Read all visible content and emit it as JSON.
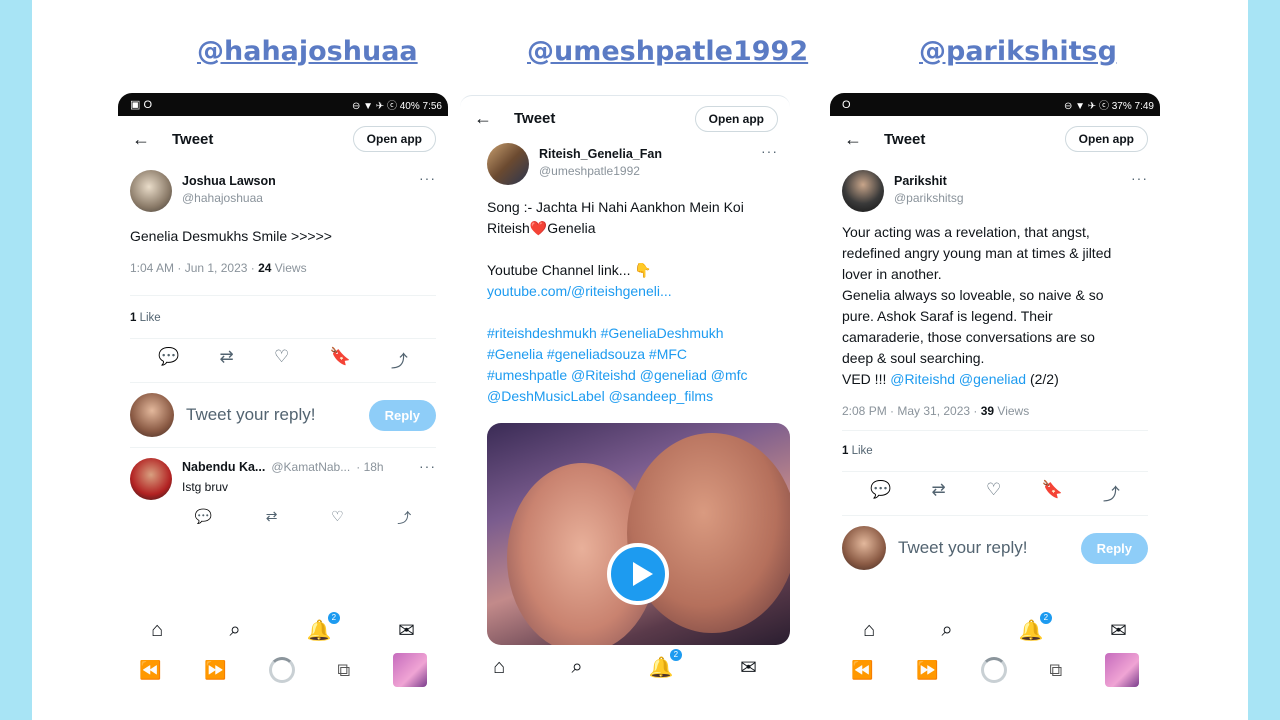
{
  "panels": [
    {
      "handle": "@hahajoshuaa",
      "status": {
        "left": "▣ O",
        "right": "⊖ ▼ ✈ ⓒ 40% 7:56"
      },
      "header": {
        "back": "←",
        "title": "Tweet",
        "open_app": "Open app"
      },
      "author": {
        "name": "Joshua Lawson",
        "handle": "@hahajoshuaa",
        "more": "···"
      },
      "text": "Genelia Desmukhs Smile >>>>>",
      "meta": {
        "time": "1:04 AM · Jun 1, 2023 · ",
        "views_count": "24",
        "views_label": " Views"
      },
      "likes": {
        "count": "1",
        "label": " Like"
      },
      "reply": {
        "placeholder": "Tweet your reply!",
        "button": "Reply"
      },
      "comment": {
        "name": "Nabendu Ka...",
        "handle": "@KamatNab...",
        "time": "· 18h",
        "more": "···",
        "text": "Istg bruv"
      }
    },
    {
      "handle": "@umeshpatle1992",
      "header": {
        "back": "←",
        "title": "Tweet",
        "open_app": "Open app"
      },
      "author": {
        "name": "Riteish_Genelia_Fan",
        "handle": "@umeshpatle1992",
        "more": "···"
      },
      "text_lines": [
        "Song :- Jachta Hi Nahi Aankhon Mein Koi",
        "Riteish",
        "Genelia",
        "Youtube Channel link... 👇"
      ],
      "link": "youtube.com/@riteishgeneli...",
      "hashtag_lines": [
        "#riteishdeshmukh #GeneliaDeshmukh",
        "#Genelia #geneliadsouza #MFC",
        "#umeshpatle @Riteishd @geneliad @mfc",
        "@DeshMusicLabel @sandeep_films"
      ]
    },
    {
      "handle": "@parikshitsg",
      "status": {
        "left": "O",
        "right": "⊖ ▼ ✈ ⓒ 37% 7:49"
      },
      "header": {
        "back": "←",
        "title": "Tweet",
        "open_app": "Open app"
      },
      "author": {
        "name": "Parikshit",
        "handle": "@parikshitsg",
        "more": "···"
      },
      "text_lines": [
        "Your acting was a revelation, that angst,",
        "redefined angry young man at times & jilted",
        "lover in another.",
        "Genelia always so loveable, so naive & so",
        "pure. Ashok Saraf is legend. Their",
        "camaraderie, those conversations are so",
        "deep & soul searching.",
        "VED !!! "
      ],
      "mentions": "@Riteishd @geneliad",
      "suffix": " (2/2)",
      "meta": {
        "time": "2:08 PM · May 31, 2023 · ",
        "views_count": "39",
        "views_label": " Views"
      },
      "likes": {
        "count": "1",
        "label": " Like"
      },
      "reply": {
        "placeholder": "Tweet your reply!",
        "button": "Reply"
      }
    }
  ],
  "nav": {
    "home": "⌂",
    "search": "⌕",
    "bell": "🔔",
    "badge": "2",
    "mail": "✉"
  },
  "browser": {
    "back": "⏪",
    "forward": "⏩",
    "tabs": "⧉"
  },
  "icons": {
    "reply": "💬",
    "retweet": "⇄",
    "like": "♡",
    "bookmark": "🔖",
    "share": "⤴",
    "heart": "❤️"
  },
  "colors": {
    "frame": "#a8e4f5",
    "handle": "#5b7bc4",
    "accent": "#1d9bf0",
    "reply_button": "#8ecdf8"
  }
}
